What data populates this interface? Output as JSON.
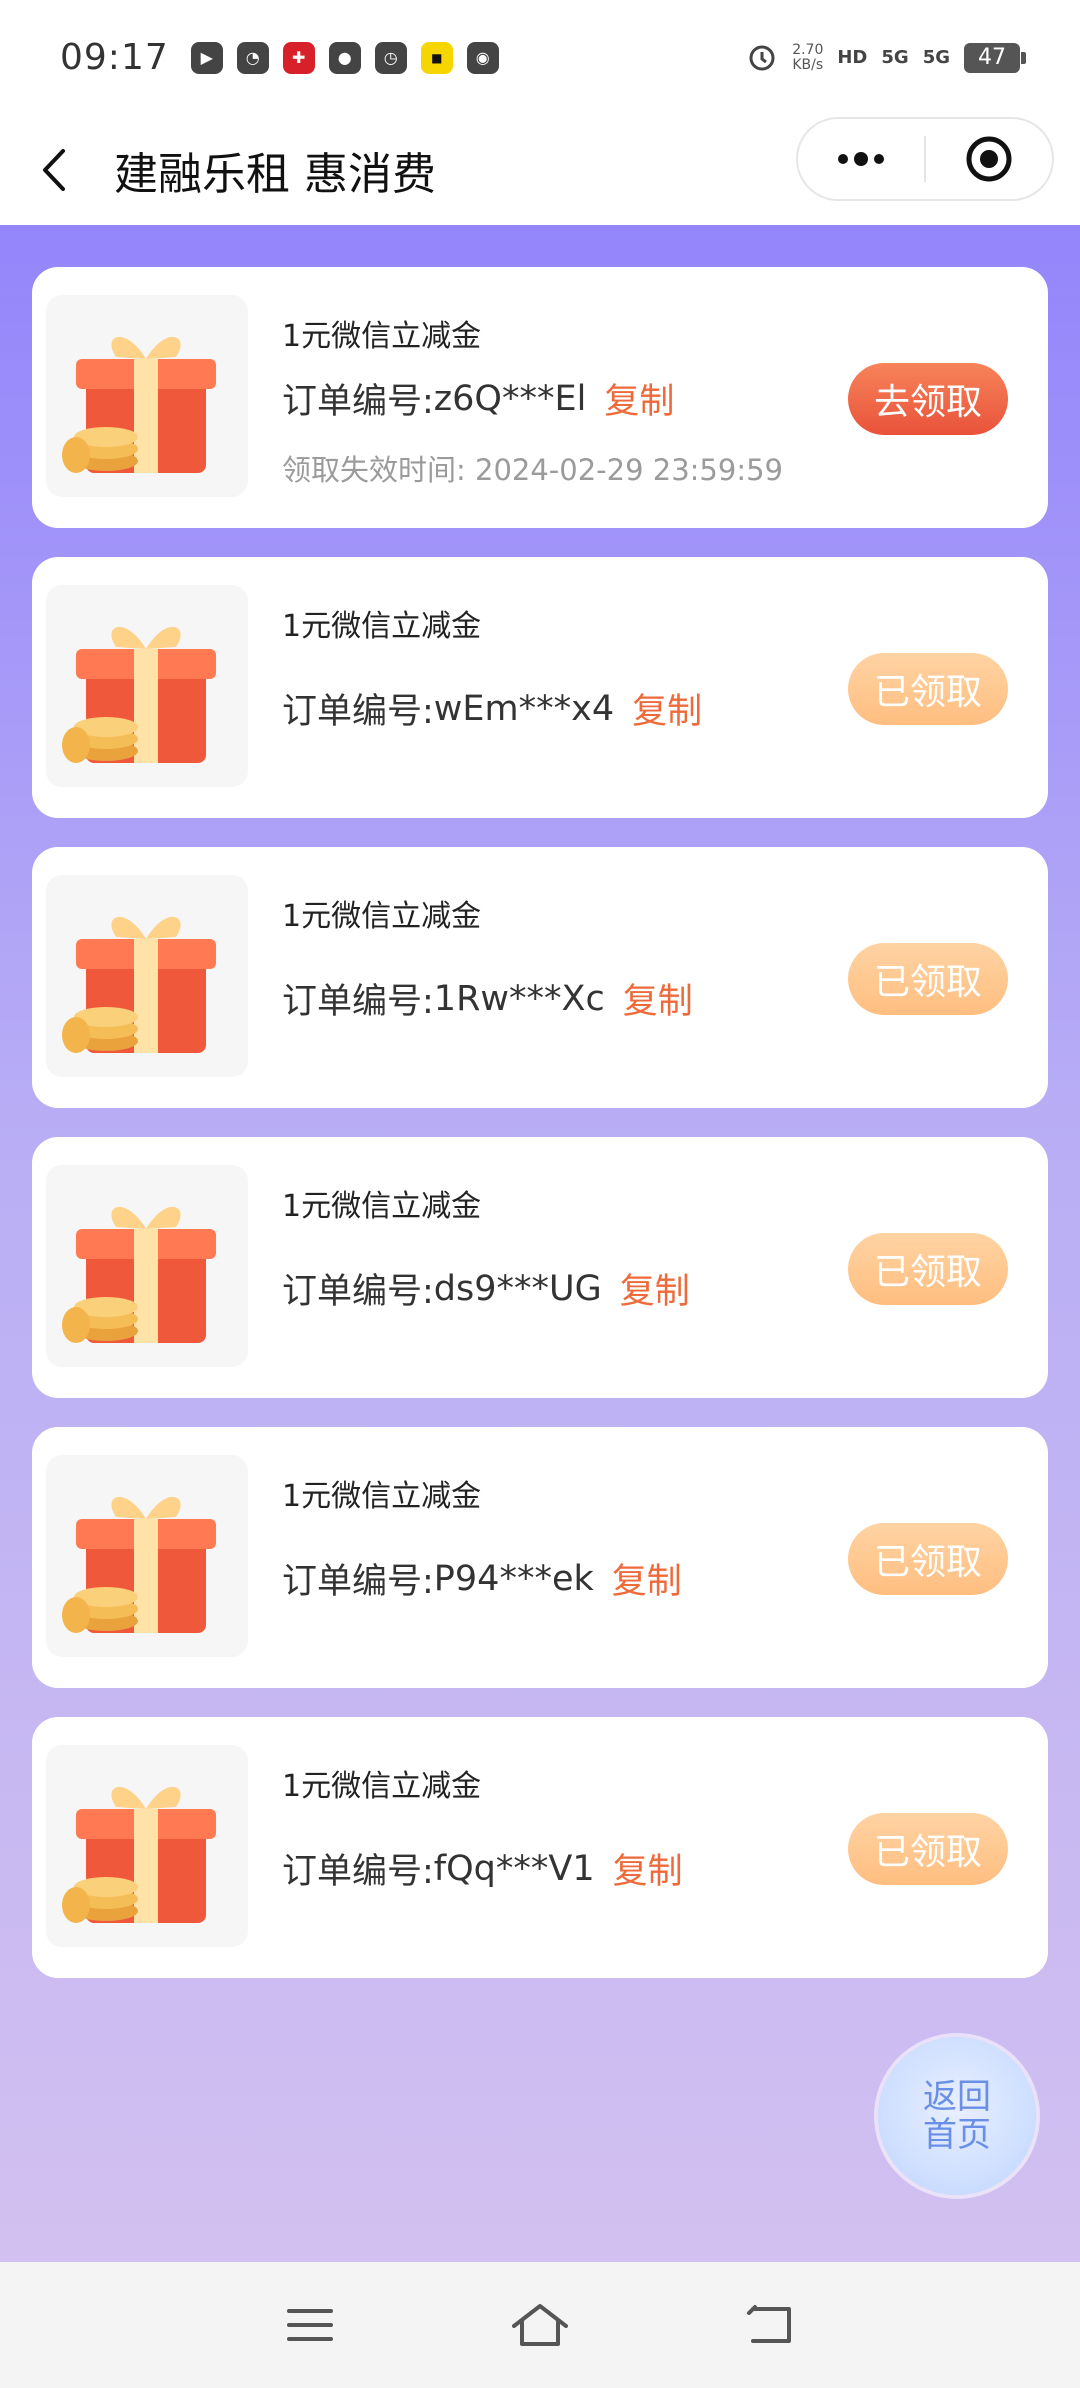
{
  "status_bar": {
    "time": "09:17",
    "speed_value": "2.70",
    "speed_unit": "KB/s",
    "hd_label": "HD",
    "sig1": "5G",
    "sig2": "5G",
    "battery": "47",
    "app_icons": [
      "play-icon",
      "ghost-icon",
      "pinduoduo-icon",
      "wechat-icon",
      "compass-icon",
      "yellow-app-icon",
      "uc-icon"
    ]
  },
  "title_bar": {
    "title": "建融乐租 惠消费"
  },
  "cards": [
    {
      "title": "1元微信立减金",
      "order_label": "订单编号:",
      "order_no": "z6Q***El",
      "copy": "复制",
      "expire": "领取失效时间: 2024-02-29 23:59:59",
      "action": "去领取",
      "state": "active"
    },
    {
      "title": "1元微信立减金",
      "order_label": "订单编号:",
      "order_no": "wEm***x4",
      "copy": "复制",
      "action": "已领取",
      "state": "done"
    },
    {
      "title": "1元微信立减金",
      "order_label": "订单编号:",
      "order_no": "1Rw***Xc",
      "copy": "复制",
      "action": "已领取",
      "state": "done"
    },
    {
      "title": "1元微信立减金",
      "order_label": "订单编号:",
      "order_no": "ds9***UG",
      "copy": "复制",
      "action": "已领取",
      "state": "done"
    },
    {
      "title": "1元微信立减金",
      "order_label": "订单编号:",
      "order_no": "P94***ek",
      "copy": "复制",
      "action": "已领取",
      "state": "done"
    },
    {
      "title": "1元微信立减金",
      "order_label": "订单编号:",
      "order_no": "fQq***V1",
      "copy": "复制",
      "action": "已领取",
      "state": "done"
    }
  ],
  "home_button": {
    "line1": "返回",
    "line2": "首页"
  },
  "colors": {
    "accent": "#ee6a3a",
    "active_button": "#e9523a",
    "done_button": "#ffbe80",
    "background_top": "#9485fb",
    "background_bottom": "#d2c0f0"
  }
}
